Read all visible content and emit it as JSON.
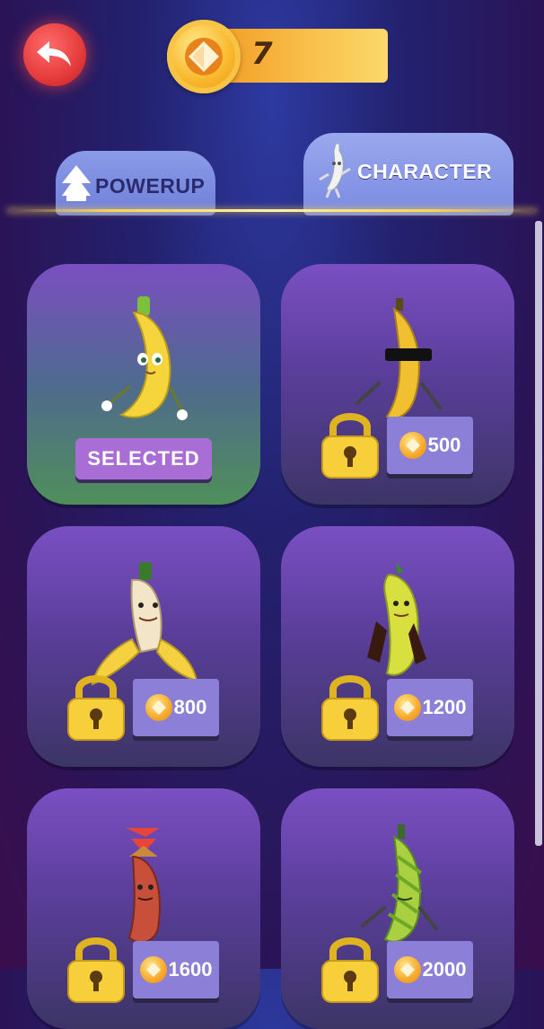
{
  "header": {
    "coins": "7"
  },
  "tabs": [
    {
      "label": "POWERUP",
      "active": false
    },
    {
      "label": "CHARACTER",
      "active": true
    }
  ],
  "characters": [
    {
      "name": "classic-banana",
      "status": "SELECTED"
    },
    {
      "name": "cool-banana",
      "price": "500"
    },
    {
      "name": "peeled-banana",
      "price": "800"
    },
    {
      "name": "crowned-banana",
      "price": "1200"
    },
    {
      "name": "propeller-banana",
      "price": "1600"
    },
    {
      "name": "striped-banana",
      "price": "2000"
    }
  ],
  "colors": {
    "accent": "#ffd44a",
    "back_button": "#e53b3b",
    "card": "#5a3e9a",
    "price_badge": "#8b7fd8"
  }
}
